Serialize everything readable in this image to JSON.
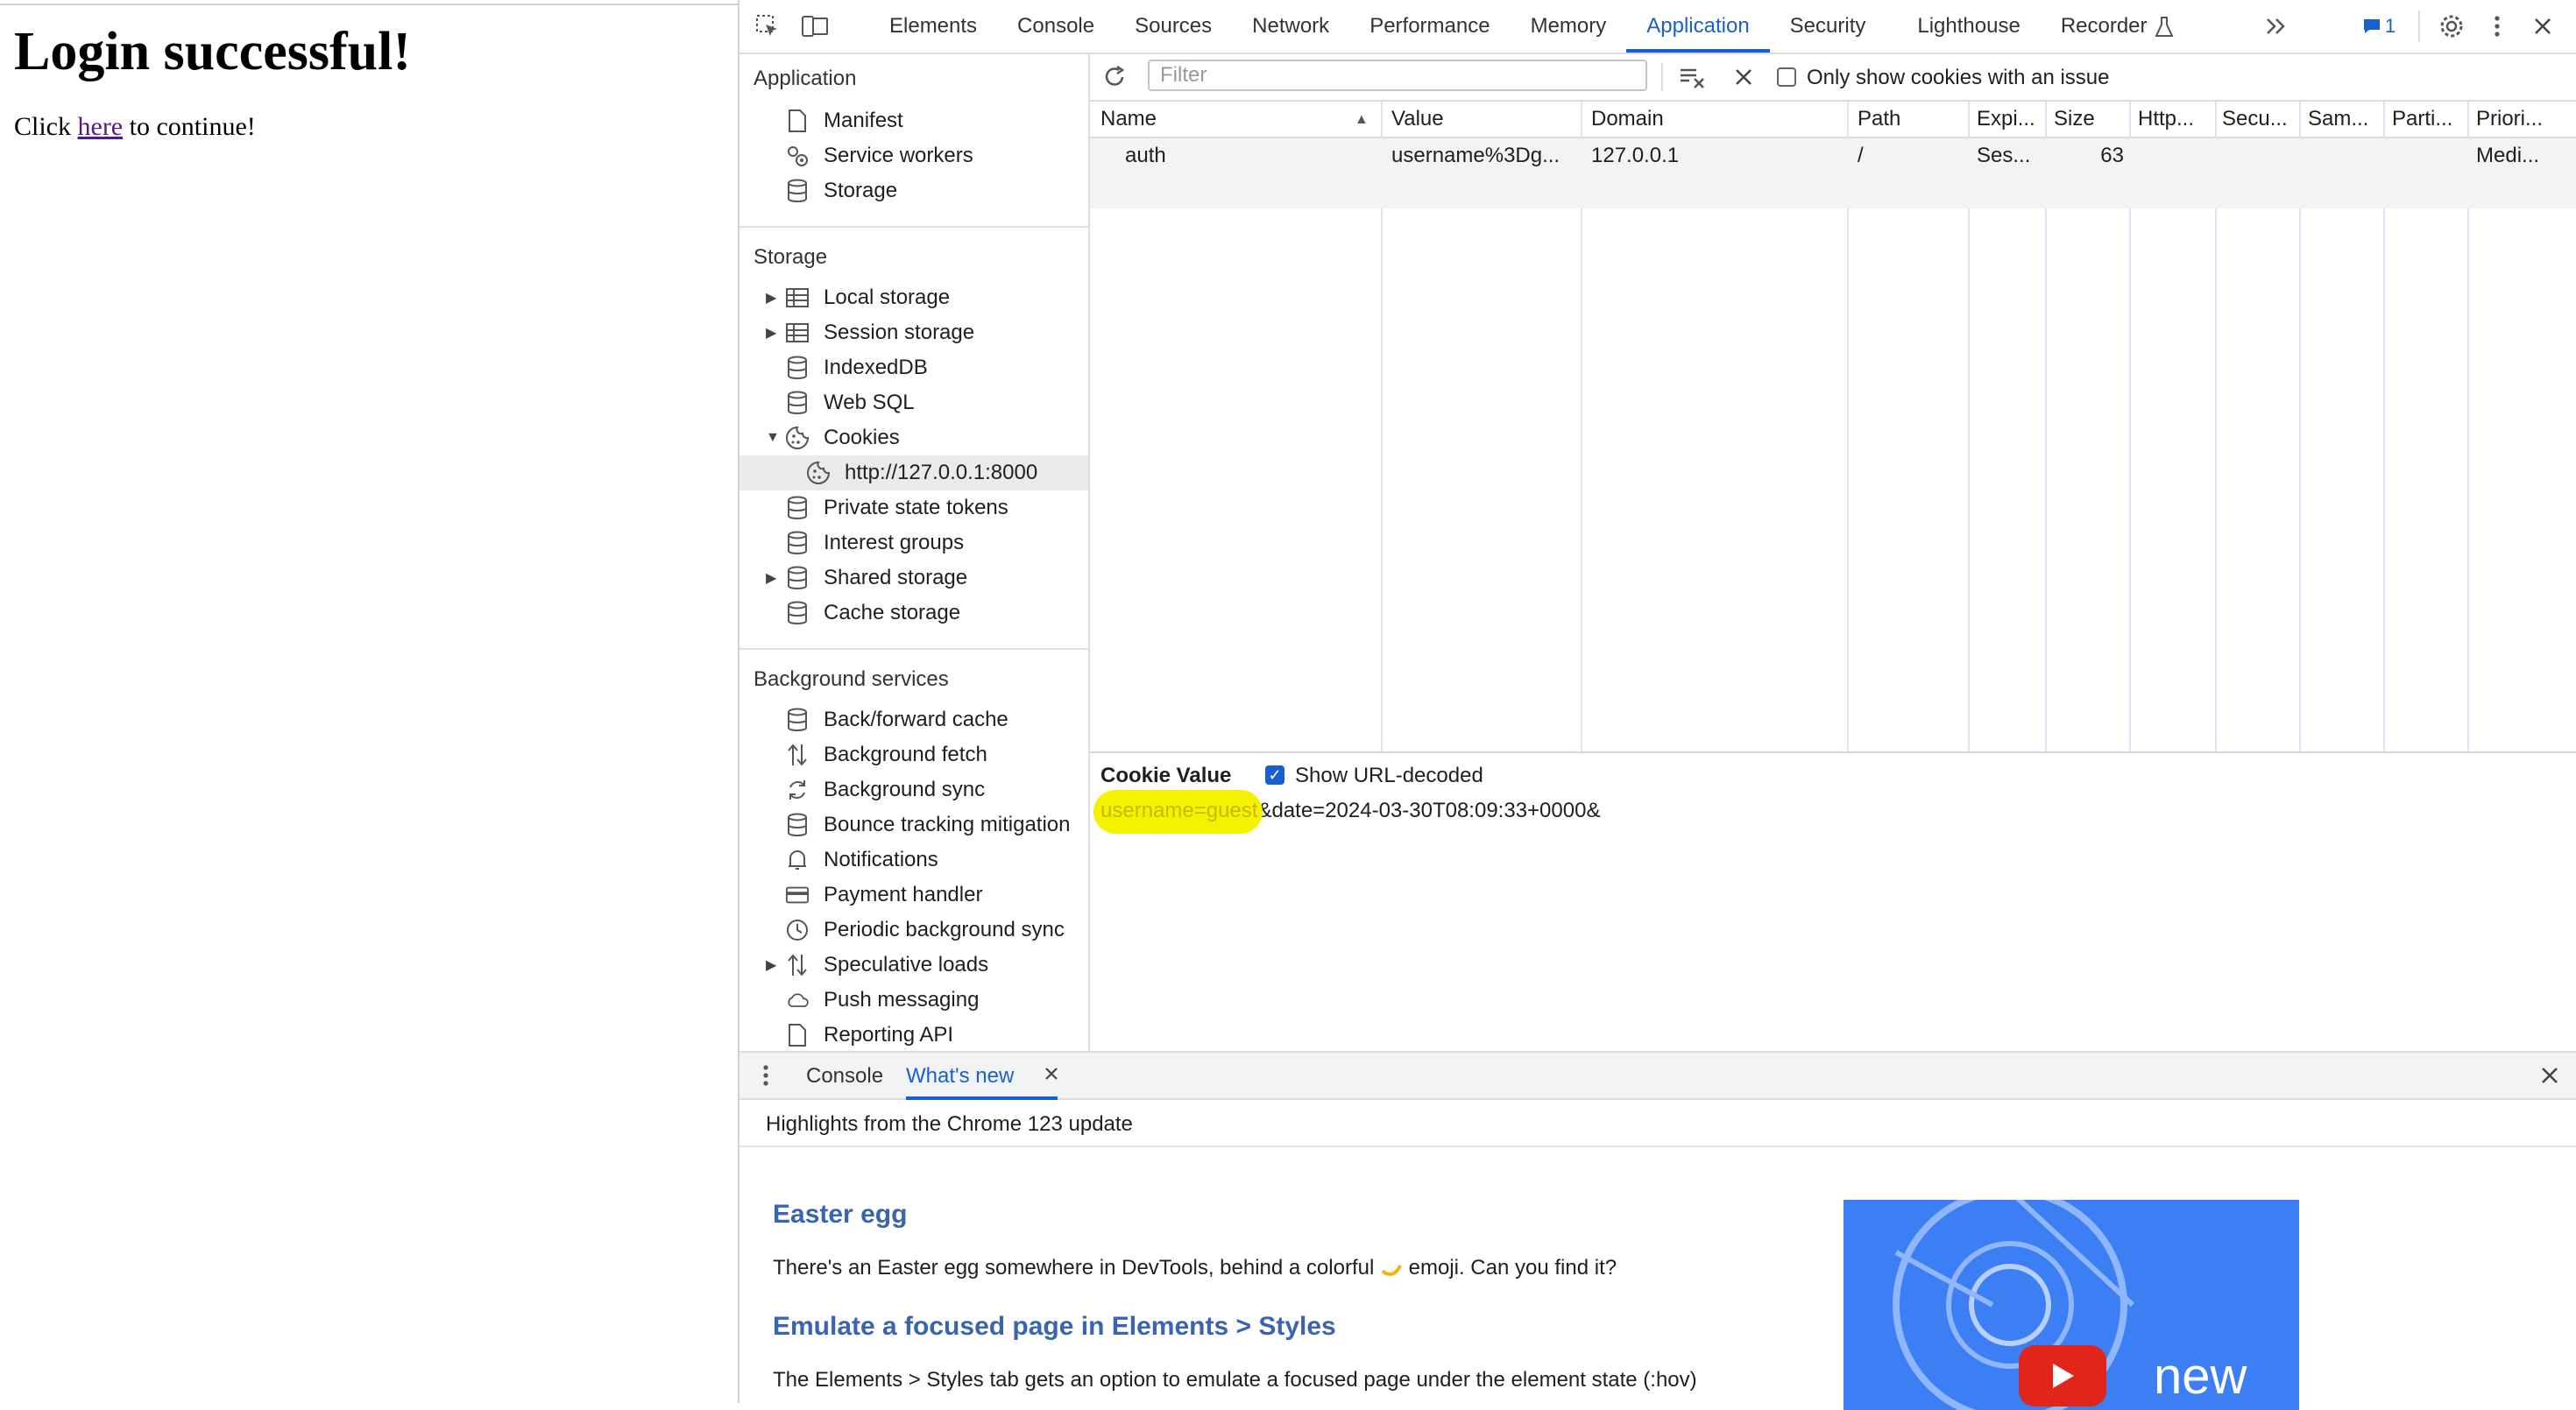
{
  "page": {
    "heading": "Login successful!",
    "text_before": "Click ",
    "link": "here",
    "text_after": " to continue!"
  },
  "devtools": {
    "tabs": [
      "Elements",
      "Console",
      "Sources",
      "Network",
      "Performance",
      "Memory",
      "Application",
      "Security",
      "Lighthouse",
      "Recorder"
    ],
    "active_tab": "Application",
    "issues_count": "1",
    "sidebar": {
      "application_title": "Application",
      "application_items": [
        {
          "label": "Manifest",
          "icon": "file-icon"
        },
        {
          "label": "Service workers",
          "icon": "gears-icon"
        },
        {
          "label": "Storage",
          "icon": "database-icon"
        }
      ],
      "storage_title": "Storage",
      "storage_items": [
        {
          "label": "Local storage",
          "icon": "table-icon",
          "expandable": true
        },
        {
          "label": "Session storage",
          "icon": "table-icon",
          "expandable": true
        },
        {
          "label": "IndexedDB",
          "icon": "database-icon"
        },
        {
          "label": "Web SQL",
          "icon": "database-icon"
        },
        {
          "label": "Cookies",
          "icon": "cookie-icon",
          "expanded": true
        },
        {
          "label": "http://127.0.0.1:8000",
          "icon": "cookie-icon",
          "sub": true,
          "selected": true
        },
        {
          "label": "Private state tokens",
          "icon": "database-icon"
        },
        {
          "label": "Interest groups",
          "icon": "database-icon"
        },
        {
          "label": "Shared storage",
          "icon": "database-icon",
          "expandable": true
        },
        {
          "label": "Cache storage",
          "icon": "database-icon"
        }
      ],
      "background_title": "Background services",
      "background_items": [
        {
          "label": "Back/forward cache",
          "icon": "database-icon"
        },
        {
          "label": "Background fetch",
          "icon": "updown-arrows-icon"
        },
        {
          "label": "Background sync",
          "icon": "sync-icon"
        },
        {
          "label": "Bounce tracking mitigation",
          "icon": "database-icon"
        },
        {
          "label": "Notifications",
          "icon": "bell-icon"
        },
        {
          "label": "Payment handler",
          "icon": "card-icon"
        },
        {
          "label": "Periodic background sync",
          "icon": "clock-icon"
        },
        {
          "label": "Speculative loads",
          "icon": "updown-arrows-icon",
          "expandable": true
        },
        {
          "label": "Push messaging",
          "icon": "cloud-icon"
        },
        {
          "label": "Reporting API",
          "icon": "file-icon"
        }
      ]
    },
    "cookies": {
      "filter_placeholder": "Filter",
      "only_issues_label": "Only show cookies with an issue",
      "columns": [
        "Name",
        "Value",
        "Domain",
        "Path",
        "Expi...",
        "Size",
        "Http...",
        "Secu...",
        "Sam...",
        "Parti...",
        "Priori..."
      ],
      "rows": [
        {
          "name": "auth",
          "value": "username%3Dg...",
          "domain": "127.0.0.1",
          "path": "/",
          "expires": "Ses...",
          "size": "63",
          "priority": "Medi..."
        }
      ],
      "cookie_value_title": "Cookie Value",
      "show_decoded_label": "Show URL-decoded",
      "show_decoded_checked": true,
      "decoded_highlight": "username=guest",
      "decoded_rest": "&date=2024-03-30T08:09:33+0000&"
    },
    "drawer": {
      "tabs": [
        "Console",
        "What's new"
      ],
      "active_tab": "What's new",
      "highlights": "Highlights from the Chrome 123 update",
      "sections": [
        {
          "title": "Easter egg",
          "body_before": "There's an Easter egg somewhere in DevTools, behind a colorful ",
          "body_after": " emoji. Can you find it?"
        },
        {
          "title": "Emulate a focused page in Elements > Styles",
          "body": "The Elements > Styles tab gets an option to emulate a focused page under the element state (:hov)"
        }
      ],
      "thumb_text": "new"
    }
  }
}
